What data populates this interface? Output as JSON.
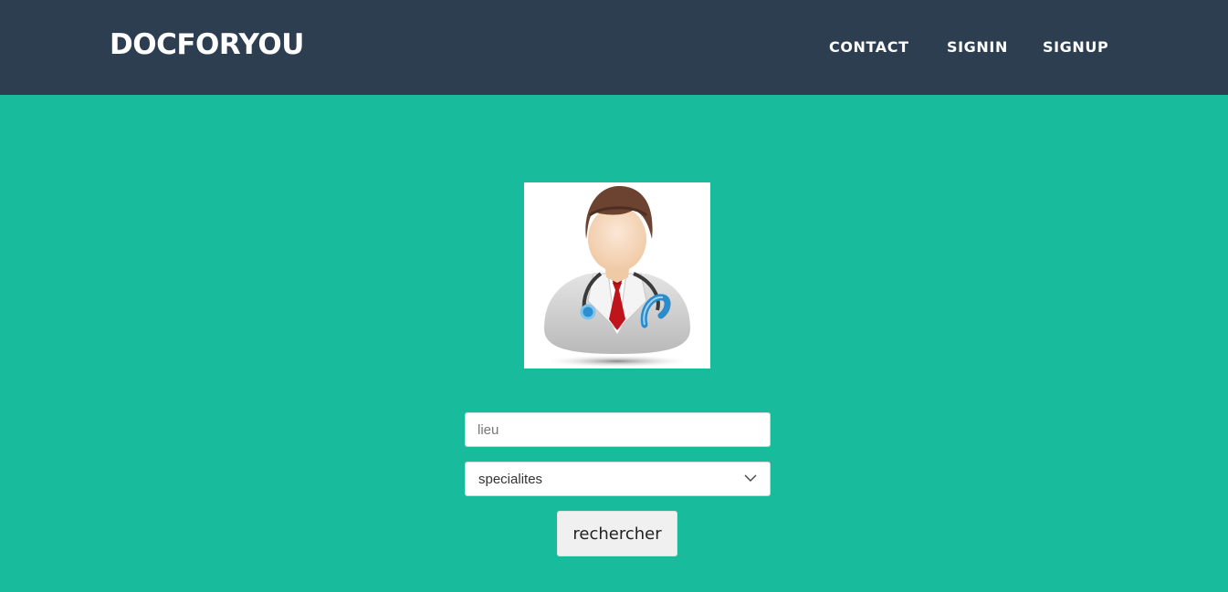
{
  "navbar": {
    "brand": "DOCFORYOU",
    "links": [
      "CONTACT",
      "SIGNIN",
      "SIGNUP"
    ]
  },
  "search": {
    "lieu_placeholder": "lieu",
    "lieu_value": "",
    "specialite_selected": "specialites",
    "button_label": "rechercher"
  },
  "colors": {
    "navbar_bg": "#2c3e50",
    "page_bg": "#18bc9c",
    "button_bg": "#f0f0f0"
  },
  "icons": {
    "doctor": "doctor-avatar-icon",
    "select_arrow": "chevron-down-icon"
  }
}
